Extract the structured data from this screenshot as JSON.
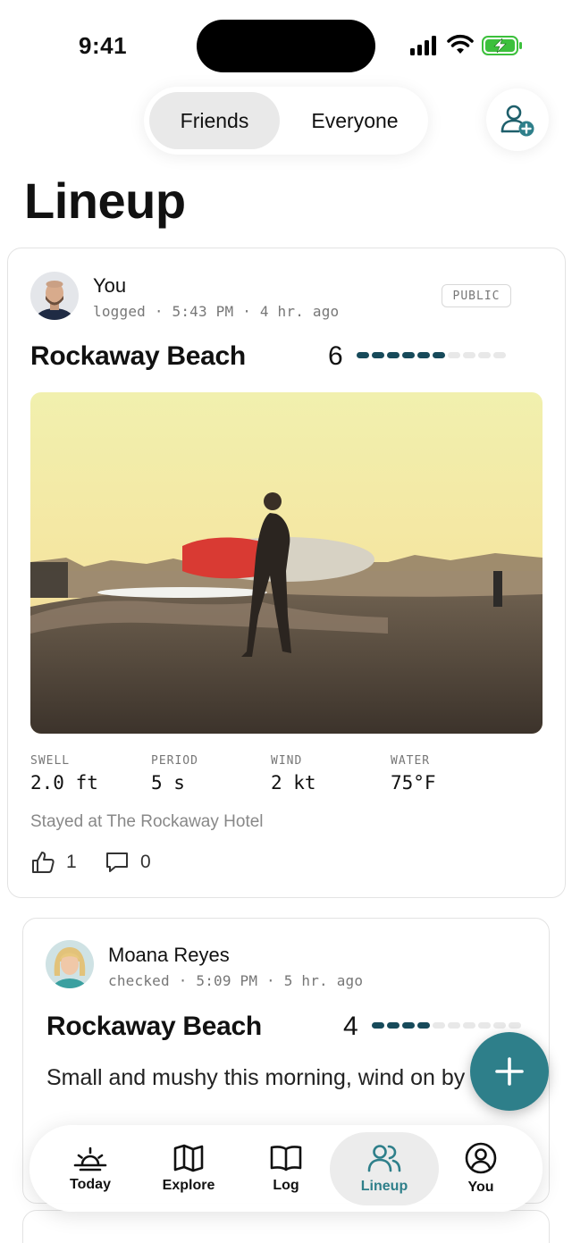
{
  "status_bar": {
    "time": "9:41"
  },
  "segmented": {
    "friends": "Friends",
    "everyone": "Everyone"
  },
  "page_title": "Lineup",
  "posts": [
    {
      "user": "You",
      "action": "logged",
      "time": "5:43 PM",
      "ago": "4 hr. ago",
      "badge": "PUBLIC",
      "spot": "Rockaway Beach",
      "rating": 6,
      "rating_max": 10,
      "stats": [
        {
          "label": "SWELL",
          "value": "2.0 ft"
        },
        {
          "label": "PERIOD",
          "value": "5 s"
        },
        {
          "label": "WIND",
          "value": "2 kt"
        },
        {
          "label": "WATER",
          "value": "75°F"
        }
      ],
      "note": "Stayed at The Rockaway Hotel",
      "likes": "1",
      "comments": "0"
    },
    {
      "user": "Moana Reyes",
      "action": "checked",
      "time": "5:09 PM",
      "ago": "5 hr. ago",
      "spot": "Rockaway Beach",
      "rating": 4,
      "rating_max": 10,
      "body": "Small and mushy this morning, wind on by 9."
    }
  ],
  "colors": {
    "accent": "#2e7f8a",
    "rating_on": "#174a5a",
    "rating_off": "#e8e8e8"
  },
  "tabbar": [
    {
      "label": "Today",
      "icon": "sunrise-icon"
    },
    {
      "label": "Explore",
      "icon": "map-icon"
    },
    {
      "label": "Log",
      "icon": "book-icon"
    },
    {
      "label": "Lineup",
      "icon": "users-icon",
      "active": true
    },
    {
      "label": "You",
      "icon": "profile-circle-icon"
    }
  ]
}
